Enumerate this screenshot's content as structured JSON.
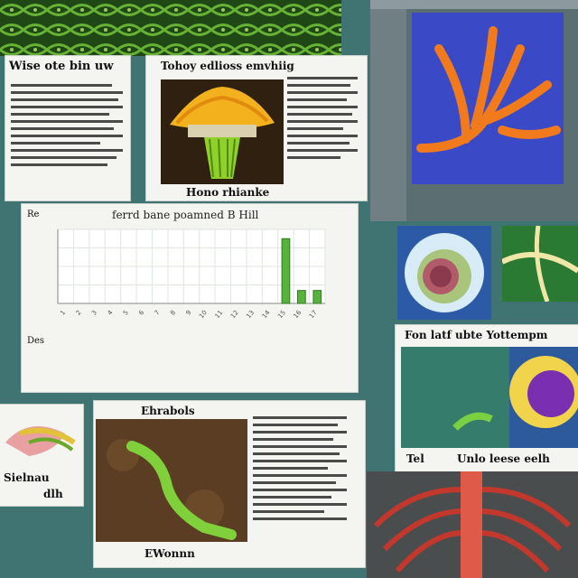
{
  "panels": {
    "left_article": {
      "title": "Wise ote bin uw",
      "caption": "Hono rhianke"
    },
    "top_middle_article": {
      "title": "Tohoy edlioss emvhiig"
    },
    "chart_card": {
      "title": "ferrd bane poamned B Hill",
      "corner_label": "Re",
      "side_label": "Des"
    },
    "right_bottom_card": {
      "title": "Fon latf ubte Yottempm",
      "caption": "Unlo leese eelh",
      "caption_prefix": "Tel"
    },
    "bottom_article": {
      "title": "Ehrabols",
      "caption": "EWonnn"
    },
    "bottom_left_card": {
      "caption_a": "Sielnau",
      "caption_b": "dlh"
    }
  },
  "chart_data": {
    "type": "bar",
    "title": "ferrd bane poamned B Hill",
    "categories": [
      "1",
      "2",
      "3",
      "4",
      "5",
      "6",
      "7",
      "8",
      "9",
      "10",
      "11",
      "12",
      "13",
      "14",
      "15",
      "16",
      "17"
    ],
    "values": [
      0,
      0,
      0,
      0,
      0,
      0,
      0,
      0,
      0,
      0,
      0,
      0,
      0,
      0,
      70,
      14,
      14
    ],
    "ylim": [
      0,
      80
    ],
    "grid": true
  },
  "colors": {
    "background": "#3f7472",
    "bar": "#58b33a",
    "bar_edge": "#2f7a22",
    "leaf_green": "#5fae2e",
    "orange": "#f07a1c",
    "blue": "#2e5fd8"
  }
}
